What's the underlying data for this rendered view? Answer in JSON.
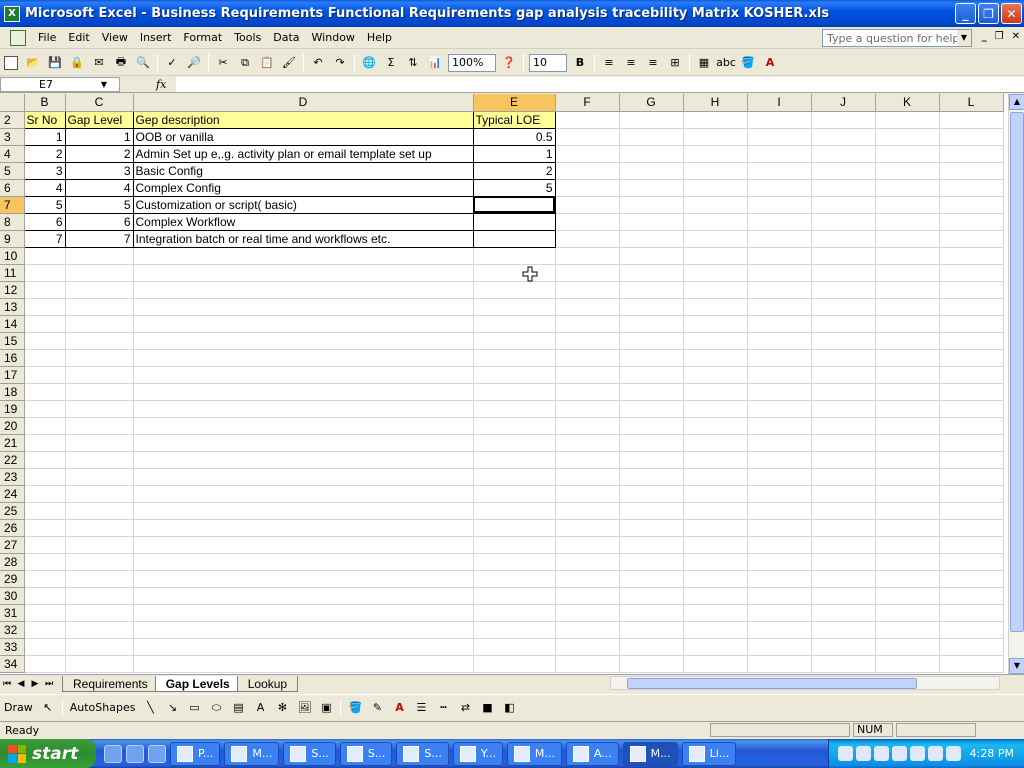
{
  "window": {
    "title": "Microsoft Excel - Business Requirements Functional Requirements gap analysis tracebility Matrix KOSHER.xls",
    "app_icon": "X"
  },
  "menu": {
    "items": [
      "File",
      "Edit",
      "View",
      "Insert",
      "Format",
      "Tools",
      "Data",
      "Window",
      "Help"
    ],
    "help_placeholder": "Type a question for help"
  },
  "toolbar": {
    "zoom": "100%",
    "font_size": "10",
    "bold": "B",
    "sum": "Σ"
  },
  "formula_bar": {
    "name_box": "E7",
    "fx": "fx",
    "formula": ""
  },
  "columns": [
    "B",
    "C",
    "D",
    "E",
    "F",
    "G",
    "H",
    "I",
    "J",
    "K",
    "L"
  ],
  "selected_column": "E",
  "selected_row": "7",
  "rows": [
    {
      "n": "2",
      "B": "Sr No",
      "C": "Gap Level",
      "D": "Gep description",
      "E": "Typical LOE"
    },
    {
      "n": "3",
      "B": "1",
      "C": "1",
      "D": "OOB or vanilla",
      "E": "0.5"
    },
    {
      "n": "4",
      "B": "2",
      "C": "2",
      "D": "Admin Set up e,.g. activity plan or email template set up",
      "E": "1"
    },
    {
      "n": "5",
      "B": "3",
      "C": "3",
      "D": "Basic Config",
      "E": "2"
    },
    {
      "n": "6",
      "B": "4",
      "C": "4",
      "D": "Complex Config",
      "E": "5"
    },
    {
      "n": "7",
      "B": "5",
      "C": "5",
      "D": "Customization or script( basic)",
      "E": ""
    },
    {
      "n": "8",
      "B": "6",
      "C": "6",
      "D": "Complex Workflow",
      "E": ""
    },
    {
      "n": "9",
      "B": "7",
      "C": "7",
      "D": "Integration batch or real time and workflows etc.",
      "E": ""
    }
  ],
  "empty_rows": [
    "10",
    "11",
    "12",
    "13",
    "14",
    "15",
    "16",
    "17",
    "18",
    "19",
    "20",
    "21",
    "22",
    "23",
    "24",
    "25",
    "26",
    "27",
    "28",
    "29",
    "30",
    "31",
    "32",
    "33",
    "34"
  ],
  "sheet_tabs": [
    {
      "label": "Requirements",
      "active": false
    },
    {
      "label": "Gap Levels",
      "active": true
    },
    {
      "label": "Lookup",
      "active": false
    }
  ],
  "draw_toolbar": {
    "draw": "Draw",
    "autoshapes": "AutoShapes"
  },
  "status": {
    "ready": "Ready",
    "num": "NUM"
  },
  "taskbar": {
    "start": "start",
    "tasks": [
      {
        "label": "P...",
        "active": false
      },
      {
        "label": "M...",
        "active": false
      },
      {
        "label": "S...",
        "active": false
      },
      {
        "label": "S...",
        "active": false
      },
      {
        "label": "S...",
        "active": false
      },
      {
        "label": "Y...",
        "active": false
      },
      {
        "label": "M...",
        "active": false
      },
      {
        "label": "A...",
        "active": false
      },
      {
        "label": "M...",
        "active": true
      },
      {
        "label": "Li...",
        "active": false
      }
    ],
    "clock": "4:28 PM"
  },
  "colors": {
    "header_fill": "#ffff99",
    "selected_header": "#f7c55e",
    "title_bar": "#0054e3"
  }
}
